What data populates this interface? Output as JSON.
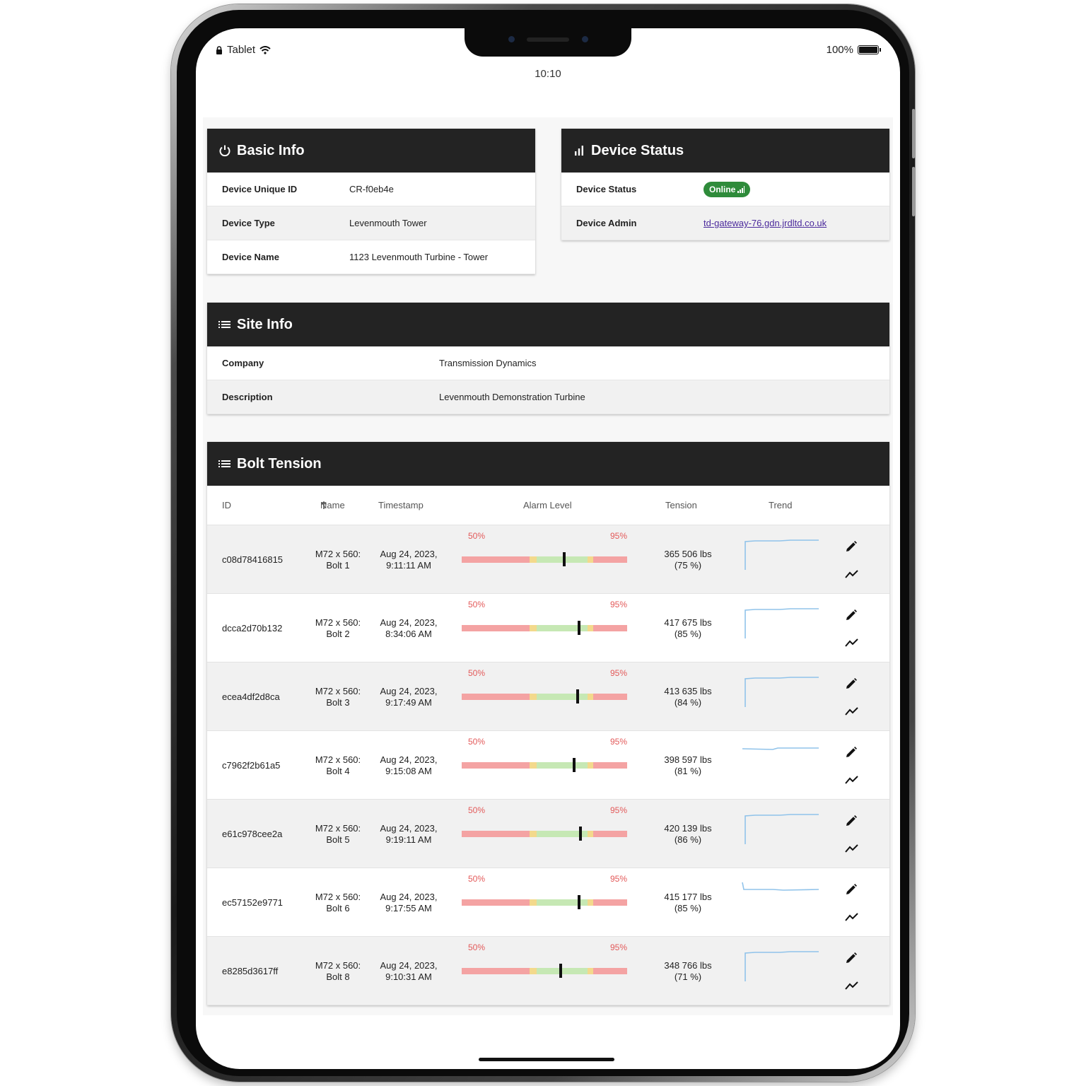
{
  "status_bar": {
    "carrier": "Tablet",
    "battery": "100%",
    "time": "10:10"
  },
  "basic_info": {
    "title": "Basic Info",
    "rows": [
      {
        "label": "Device Unique ID",
        "value": "CR-f0eb4e"
      },
      {
        "label": "Device Type",
        "value": "Levenmouth Tower"
      },
      {
        "label": "Device Name",
        "value": "1123 Levenmouth Turbine - Tower"
      }
    ]
  },
  "device_status": {
    "title": "Device Status",
    "status_label": "Device Status",
    "status_value": "Online",
    "admin_label": "Device Admin",
    "admin_value": "td-gateway-76.gdn.jrdltd.co.uk",
    "online_color": "#2e8b3a"
  },
  "site_info": {
    "title": "Site Info",
    "rows": [
      {
        "label": "Company",
        "value": "Transmission Dynamics"
      },
      {
        "label": "Description",
        "value": "Levenmouth Demonstration Turbine"
      }
    ]
  },
  "bolt_tension": {
    "title": "Bolt Tension",
    "columns": {
      "id": "ID",
      "name": "Name",
      "timestamp": "Timestamp",
      "alarm": "Alarm Level",
      "tension": "Tension",
      "trend": "Trend"
    },
    "alarm_low_label": "50%",
    "alarm_high_label": "95%",
    "rows": [
      {
        "id": "c08d78416815",
        "name1": "M72 x 560:",
        "name2": "Bolt 1",
        "ts1": "Aug 24, 2023,",
        "ts2": "9:11:11 AM",
        "t1": "365 506 lbs",
        "t2": "(75 %)",
        "level": 0.62,
        "trend_shape": "step"
      },
      {
        "id": "dcca2d70b132",
        "name1": "M72 x 560:",
        "name2": "Bolt 2",
        "ts1": "Aug 24, 2023,",
        "ts2": "8:34:06 AM",
        "t1": "417 675 lbs",
        "t2": "(85 %)",
        "level": 0.71,
        "trend_shape": "step"
      },
      {
        "id": "ecea4df2d8ca",
        "name1": "M72 x 560:",
        "name2": "Bolt 3",
        "ts1": "Aug 24, 2023,",
        "ts2": "9:17:49 AM",
        "t1": "413 635 lbs",
        "t2": "(84 %)",
        "level": 0.7,
        "trend_shape": "step"
      },
      {
        "id": "c7962f2b61a5",
        "name1": "M72 x 560:",
        "name2": "Bolt 4",
        "ts1": "Aug 24, 2023,",
        "ts2": "9:15:08 AM",
        "t1": "398 597 lbs",
        "t2": "(81 %)",
        "level": 0.68,
        "trend_shape": "flat"
      },
      {
        "id": "e61c978cee2a",
        "name1": "M72 x 560:",
        "name2": "Bolt 5",
        "ts1": "Aug 24, 2023,",
        "ts2": "9:19:11 AM",
        "t1": "420 139 lbs",
        "t2": "(86 %)",
        "level": 0.72,
        "trend_shape": "step"
      },
      {
        "id": "ec57152e9771",
        "name1": "M72 x 560:",
        "name2": "Bolt 6",
        "ts1": "Aug 24, 2023,",
        "ts2": "9:17:55 AM",
        "t1": "415 177 lbs",
        "t2": "(85 %)",
        "level": 0.71,
        "trend_shape": "drop"
      },
      {
        "id": "e8285d3617ff",
        "name1": "M72 x 560:",
        "name2": "Bolt 8",
        "ts1": "Aug 24, 2023,",
        "ts2": "9:10:31 AM",
        "t1": "348 766 lbs",
        "t2": "(71 %)",
        "level": 0.6,
        "trend_shape": "step"
      }
    ]
  },
  "colors": {
    "header_bg": "#232323",
    "alarm_red": "#f4a3a3",
    "alarm_yellow": "#f3d98c",
    "alarm_green": "#c6e8b4",
    "trend_line": "#90c3ea"
  },
  "icons": {
    "basic_info": "power-icon",
    "device_status": "signal-bars-icon",
    "site_info": "list-icon",
    "bolt_tension": "list-icon",
    "row_edit": "pencil-icon",
    "row_trend": "trend-line-icon",
    "sort": "arrow-up-icon"
  }
}
